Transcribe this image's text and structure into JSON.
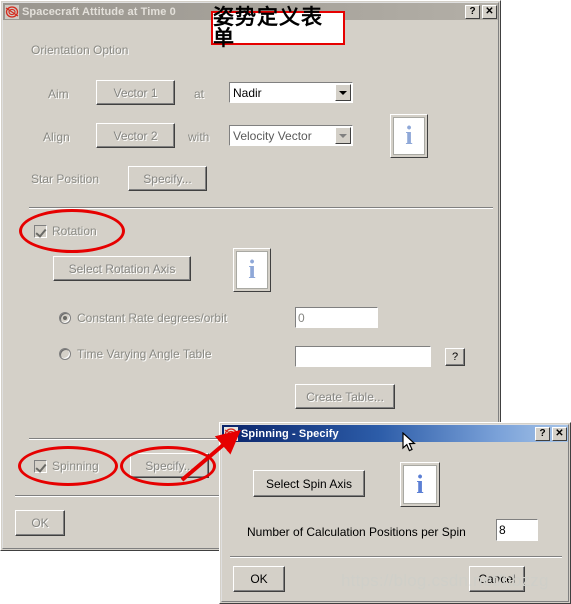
{
  "main_window": {
    "title": "Spacecraft Attitude at Time 0",
    "titlebar_state": "inactive",
    "help_button": "?",
    "close_button": "✕",
    "sections": {
      "orientation": {
        "legend": "Orientation Option",
        "aim_label": "Aim",
        "aim_button": "Vector 1",
        "at_label": "at",
        "aim_target_value": "Nadir",
        "align_label": "Align",
        "align_button": "Vector 2",
        "with_label": "with",
        "align_target_value": "Velocity Vector",
        "info_glyph": "i",
        "star_position_label": "Star Position",
        "star_position_button": "Specify..."
      },
      "rotation": {
        "checkbox_label": "Rotation",
        "checkbox_checked": true,
        "select_axis_button": "Select Rotation Axis",
        "info_glyph": "i",
        "constant_rate_label": "Constant Rate degrees/orbit",
        "constant_rate_selected": true,
        "constant_rate_value": "0",
        "time_varying_label": "Time Varying Angle Table",
        "time_varying_selected": false,
        "time_varying_value": "",
        "time_varying_help_button": "?",
        "create_table_button": "Create Table..."
      },
      "spinning": {
        "checkbox_label": "Spinning",
        "checkbox_checked": true,
        "specify_button": "Specify..."
      }
    },
    "ok_button": "OK"
  },
  "spinning_dialog": {
    "title": "Spinning - Specify",
    "titlebar_state": "active",
    "help_button": "?",
    "close_button": "✕",
    "select_spin_axis_button": "Select Spin Axis",
    "info_glyph": "i",
    "positions_label": "Number of Calculation Positions per Spin",
    "positions_value": "8",
    "ok_button": "OK",
    "cancel_button": "Cancel"
  },
  "annotations": {
    "title_note": "姿势定义表单",
    "accent_color": "#e60000",
    "ellipse_targets": [
      "rotation-checkbox",
      "spinning-checkbox",
      "spinning-specify-button"
    ],
    "arrow_from": "spinning-specify-button",
    "arrow_to": "spinning-dialog-titlebar"
  },
  "watermark": {
    "text": "https://blog.csdn.net/hbzzg"
  }
}
